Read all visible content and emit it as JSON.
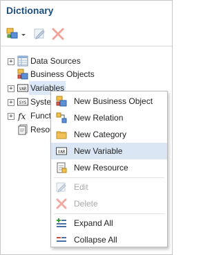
{
  "panel": {
    "title": "Dictionary"
  },
  "toolbar": {
    "new_icon": "new-item-dropdown-icon",
    "edit_icon": "edit-icon",
    "delete_icon": "delete-icon"
  },
  "tree": {
    "items": [
      {
        "label": "Data Sources",
        "icon": "data-sources-icon",
        "expander": "+"
      },
      {
        "label": "Business Objects",
        "icon": "business-objects-icon",
        "expander": ""
      },
      {
        "label": "Variables",
        "icon": "variables-icon",
        "expander": "+"
      },
      {
        "label": "Syste",
        "icon": "system-variables-icon",
        "expander": "+"
      },
      {
        "label": "Functi",
        "icon": "functions-icon",
        "expander": "+"
      },
      {
        "label": "Resou",
        "icon": "resources-icon",
        "expander": ""
      }
    ]
  },
  "context_menu": {
    "items": [
      {
        "label": "New Business Object",
        "icon": "new-business-object-icon",
        "enabled": true
      },
      {
        "label": "New Relation",
        "icon": "new-relation-icon",
        "enabled": true
      },
      {
        "label": "New Category",
        "icon": "folder-icon",
        "enabled": true
      },
      {
        "label": "New Variable",
        "icon": "new-variable-icon",
        "enabled": true,
        "highlighted": true
      },
      {
        "label": "New Resource",
        "icon": "new-resource-icon",
        "enabled": true
      },
      {
        "label": "Edit",
        "icon": "edit-icon",
        "enabled": false
      },
      {
        "label": "Delete",
        "icon": "delete-icon",
        "enabled": false
      },
      {
        "label": "Expand All",
        "icon": "expand-all-icon",
        "enabled": true
      },
      {
        "label": "Collapse All",
        "icon": "collapse-all-icon",
        "enabled": true
      }
    ]
  },
  "colors": {
    "title": "#1c4e80",
    "highlight": "#dae6f4",
    "disabled_text": "#a8a8a8"
  }
}
